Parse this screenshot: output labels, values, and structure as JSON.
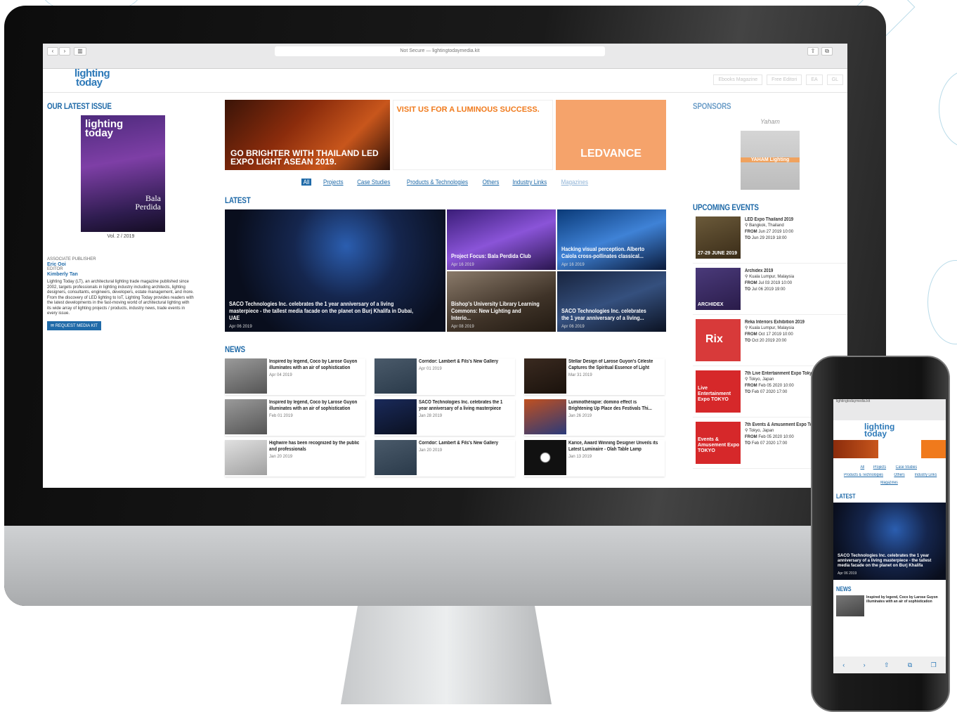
{
  "browser": {
    "url_text": "Not Secure — lightingtodaymedia.kit",
    "nav_back": "‹",
    "nav_fwd": "›"
  },
  "site": {
    "logo_line1": "lighting",
    "logo_line2": "today",
    "top_links": [
      "Ebooks Magazine",
      "Free Editori",
      "EA",
      "GL"
    ]
  },
  "left": {
    "issue_title": "OUR LATEST ISSUE",
    "cover_logo1": "lighting",
    "cover_logo2": "today",
    "cover_name1": "Bala",
    "cover_name2": "Perdida",
    "vol": "Vol. 2 / 2019",
    "staff": [
      {
        "role": "ASSOCIATE PUBLISHER",
        "name": "Eric Ooi"
      },
      {
        "role": "EDITOR",
        "name": "Kimberly Tan"
      }
    ],
    "about1": "Lighting Today (LT), an architectural lighting trade magazine published since 2002, targets professionals in lighting industry including architects, lighting designers, consultants, engineers, developers, estate management, and more.",
    "about2": "From the discovery of LED lighting to IoT, Lighting Today provides readers with the latest developments in the fast-moving world of architectural lighting with its wide array of lighting projects / products, industry news, trade events in every issue.",
    "media_kit": "REQUEST MEDIA KIT"
  },
  "banners": {
    "b1": "GO BRIGHTER WITH THAILAND LED EXPO LIGHT ASEAN 2019.",
    "b2": "VISIT US FOR A LUMINOUS SUCCESS.",
    "b3": "LEDVANCE"
  },
  "categories": [
    "All",
    "Projects",
    "Case Studies",
    "Products & Technologies",
    "Others",
    "Industry Links",
    "Magazines"
  ],
  "latest": {
    "title": "LATEST",
    "items": [
      {
        "title": "SACO Technologies Inc. celebrates the 1 year anniversary of a living masterpiece - the tallest media facade on the planet on Burj Khalifa in Dubai, UAE",
        "date": "Apr 06 2019"
      },
      {
        "title": "Project Focus: Bala Perdida Club",
        "date": "Apr 16 2019"
      },
      {
        "title": "Hacking visual perception. Alberto Caiola cross-pollinates classical...",
        "date": "Apr 16 2019"
      },
      {
        "title": "Bishop's University Library Learning Commons: New Lighting and Interio...",
        "date": "Apr 08 2019"
      },
      {
        "title": "SACO Technologies Inc. celebrates the 1 year anniversary of a living...",
        "date": "Apr 06 2019"
      }
    ]
  },
  "news": {
    "title": "NEWS",
    "items": [
      {
        "title": "Inspired by legend, Coco by Larose Guyon illuminates with an air of sophistication",
        "date": "Apr 04 2019"
      },
      {
        "title": "Corridor: Lambert & Fils's New Gallery",
        "date": "Apr 01 2019"
      },
      {
        "title": "Stellar Design of Larose Guyon's Céleste Captures the Spiritual Essence of Light",
        "date": "Mar 31 2019"
      },
      {
        "title": "Inspired by legend, Coco by Larose Guyon illuminates with an air of sophistication",
        "date": "Feb 01 2019"
      },
      {
        "title": "SACO Technologies Inc. celebrates the 1 year anniversary of a living masterpiece",
        "date": "Jan 28 2019"
      },
      {
        "title": "Luminothérapie: domino effect is Brightening Up Place des Festivals Thi...",
        "date": "Jan 26 2019"
      },
      {
        "title": "Highwire has been recognized by the public and professionals",
        "date": "Jan 20 2019"
      },
      {
        "title": "Corridor: Lambert & Fils's New Gallery",
        "date": "Jan 20 2019"
      },
      {
        "title": "Karice, Award Winning Designer Unveils its Latest Luminaire - Olah Table Lamp",
        "date": "Jan 13 2019"
      }
    ]
  },
  "right": {
    "sponsors_title": "SPONSORS",
    "sponsor_name": "Yaham",
    "sponsor_logo": "YAHAM Lighting",
    "events_title": "UPCOMING EVENTS",
    "events": [
      {
        "name": "LED Expo Thailand 2019",
        "place": "Bangkok, Thailand",
        "from": "Jun 27 2019 10:00",
        "to": "Jun 29 2019 18:00",
        "img": "27-29 JUNE 2019"
      },
      {
        "name": "Archidex 2019",
        "place": "Kuala Lumpur, Malaysia",
        "from": "Jul 03 2019 10:00",
        "to": "Jul 06 2019 19:00",
        "img": "ARCHIDEX"
      },
      {
        "name": "Reka Interiors Exhibition 2019",
        "place": "Kuala Lumpur, Malaysia",
        "from": "Oct 17 2019 10:00",
        "to": "Oct 20 2019 20:00",
        "img": "Rix"
      },
      {
        "name": "7th Live Entertainment Expo Tokyo",
        "place": "Tokyo, Japan",
        "from": "Feb 05 2020 10:00",
        "to": "Feb 07 2020 17:00",
        "img": "Live Entertainment Expo TOKYO"
      },
      {
        "name": "7th Events & Amusement Expo Tokyo",
        "place": "Tokyo, Japan",
        "from": "Feb 05 2020 10:00",
        "to": "Feb 07 2020 17:00",
        "img": "Events & Amusement Expo TOKYO"
      }
    ],
    "from_label": "FROM",
    "to_label": "TO"
  },
  "phone": {
    "url": "lightingtodaymedia.kit",
    "logo1": "lighting",
    "logo2": "today",
    "cats": [
      "All",
      "Projects",
      "Case Studies",
      "Products & Technologies",
      "Others",
      "Industry Links",
      "Magazines"
    ],
    "latest": "LATEST",
    "latest_title": "SACO Technologies Inc. celebrates the 1 year anniversary of a living masterpiece - the tallest media facade on the planet on Burj Khalifa",
    "latest_date": "Apr 06 2019",
    "news": "NEWS",
    "news_title": "Inspired by legend, Coco by Larose Guyon illuminates with an air of sophistication",
    "footer_icons": [
      "‹",
      "›",
      "⇧",
      "⧉",
      "❐"
    ]
  }
}
